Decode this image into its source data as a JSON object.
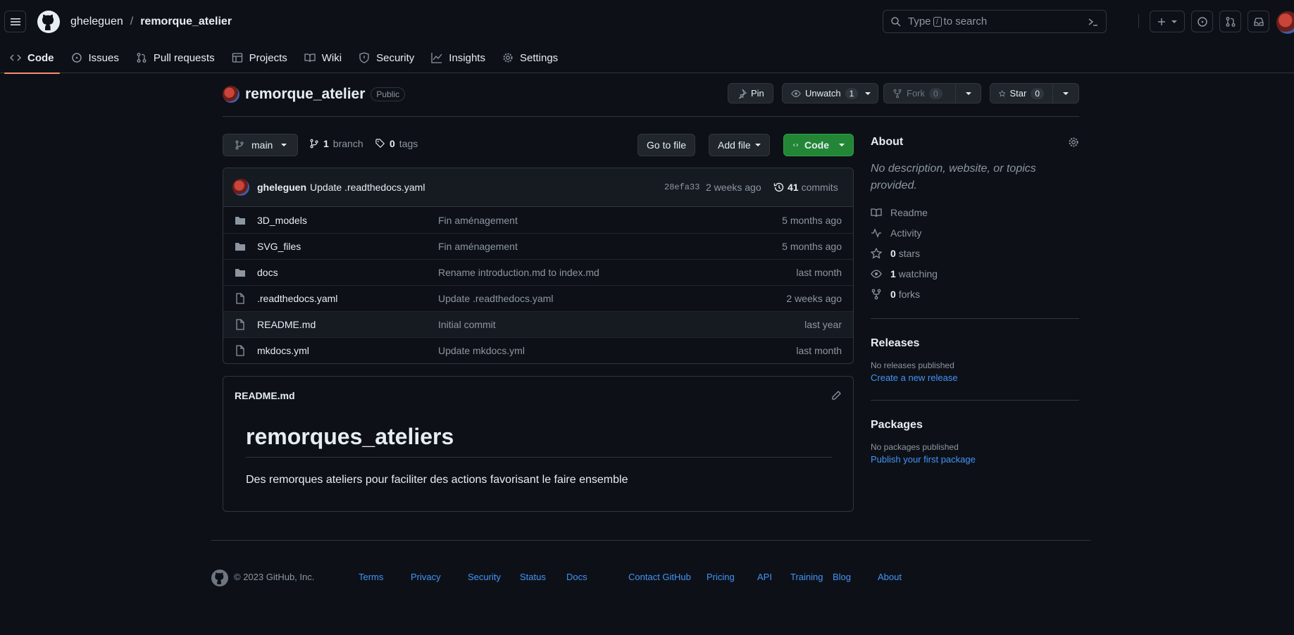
{
  "header": {
    "owner": "gheleguen",
    "separator": "/",
    "repo": "remorque_atelier",
    "search_prefix": "Type",
    "search_slash": "/",
    "search_suffix": "to search"
  },
  "tabs": [
    {
      "label": "Code",
      "icon": "code-icon",
      "selected": true
    },
    {
      "label": "Issues",
      "icon": "issue-icon"
    },
    {
      "label": "Pull requests",
      "icon": "pull-request-icon"
    },
    {
      "label": "Projects",
      "icon": "table-icon"
    },
    {
      "label": "Wiki",
      "icon": "book-icon"
    },
    {
      "label": "Security",
      "icon": "shield-icon"
    },
    {
      "label": "Insights",
      "icon": "graph-icon"
    },
    {
      "label": "Settings",
      "icon": "gear-icon"
    }
  ],
  "repo": {
    "name": "remorque_atelier",
    "visibility": "Public",
    "pin": "Pin",
    "unwatch": "Unwatch",
    "watch_count": "1",
    "fork": "Fork",
    "fork_count": "0",
    "star": "Star",
    "star_count": "0"
  },
  "toolbar": {
    "branch": "main",
    "branch_count": "1",
    "branch_label": "branch",
    "tag_count": "0",
    "tag_label": "tags",
    "go_to_file": "Go to file",
    "add_file": "Add file",
    "code": "Code"
  },
  "commit": {
    "author": "gheleguen",
    "message": "Update .readthedocs.yaml",
    "sha": "28efa33",
    "age": "2 weeks ago",
    "count": "41",
    "count_label": "commits"
  },
  "files": [
    {
      "name": "3D_models",
      "type": "dir",
      "message": "Fin aménagement",
      "age": "5 months ago"
    },
    {
      "name": "SVG_files",
      "type": "dir",
      "message": "Fin aménagement",
      "age": "5 months ago"
    },
    {
      "name": "docs",
      "type": "dir",
      "message": "Rename introduction.md to index.md",
      "age": "last month"
    },
    {
      "name": ".readthedocs.yaml",
      "type": "file",
      "message": "Update .readthedocs.yaml",
      "age": "2 weeks ago"
    },
    {
      "name": "README.md",
      "type": "file",
      "message": "Initial commit",
      "age": "last year"
    },
    {
      "name": "mkdocs.yml",
      "type": "file",
      "message": "Update mkdocs.yml",
      "age": "last month"
    }
  ],
  "readme": {
    "filename": "README.md",
    "heading": "remorques_ateliers",
    "body": "Des remorques ateliers pour faciliter des actions favorisant le faire ensemble"
  },
  "about": {
    "title": "About",
    "description": "No description, website, or topics provided.",
    "readme": "Readme",
    "activity": "Activity",
    "stars_count": "0",
    "stars_label": "stars",
    "watching_count": "1",
    "watching_label": "watching",
    "forks_count": "0",
    "forks_label": "forks"
  },
  "releases": {
    "title": "Releases",
    "empty": "No releases published",
    "link": "Create a new release"
  },
  "packages": {
    "title": "Packages",
    "empty": "No packages published",
    "link": "Publish your first package"
  },
  "footer": {
    "copyright": "© 2023 GitHub, Inc.",
    "links": [
      "Terms",
      "Privacy",
      "Security",
      "Status",
      "Docs",
      "Contact GitHub",
      "Pricing",
      "API",
      "Training",
      "Blog",
      "About"
    ]
  },
  "colors": {
    "accent": "#238636",
    "link": "#4493f8",
    "tab_underline": "#fd8c73"
  }
}
